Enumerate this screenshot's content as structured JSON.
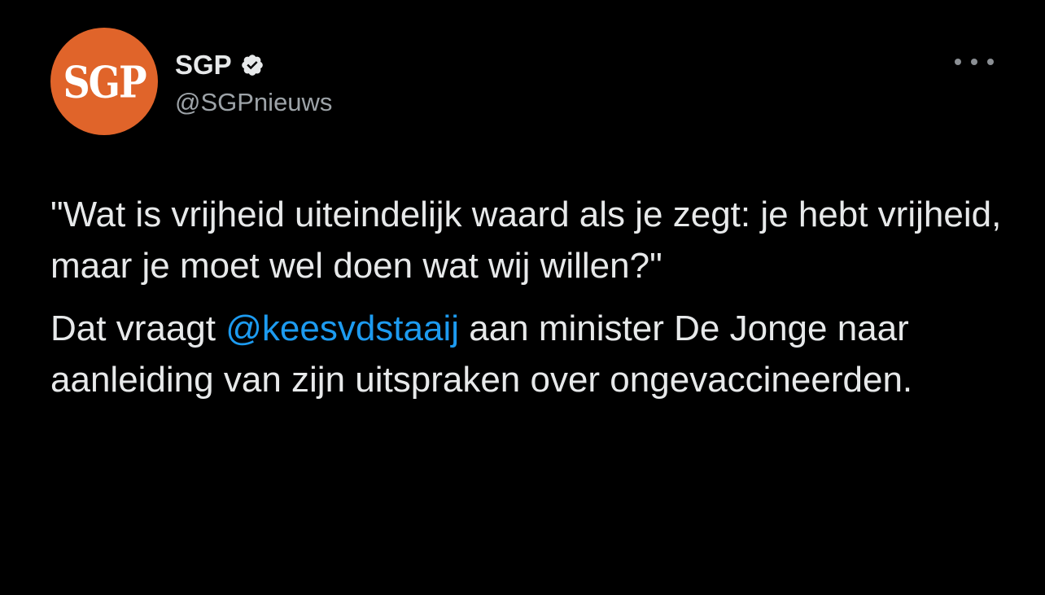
{
  "author": {
    "avatar_text": "SGP",
    "display_name": "SGP",
    "handle": "@SGPnieuws",
    "verified_icon": "verified-badge-icon"
  },
  "more_menu": {
    "icon": "more-horizontal-icon"
  },
  "tweet": {
    "paragraph_1": "\"Wat is vrijheid uiteindelijk waard als je zegt: je hebt vrijheid, maar je moet wel doen wat wij willen?\"",
    "paragraph_2_before": "Dat vraagt ",
    "mention": "@keesvdstaaij",
    "paragraph_2_after": " aan minister De Jonge naar aanleiding van zijn uitspraken over ongevaccineerden."
  },
  "colors": {
    "background": "#000000",
    "text": "#e7e9ea",
    "secondary_text": "#9da3a8",
    "link": "#1d9bf0",
    "avatar": "#e0642a"
  }
}
